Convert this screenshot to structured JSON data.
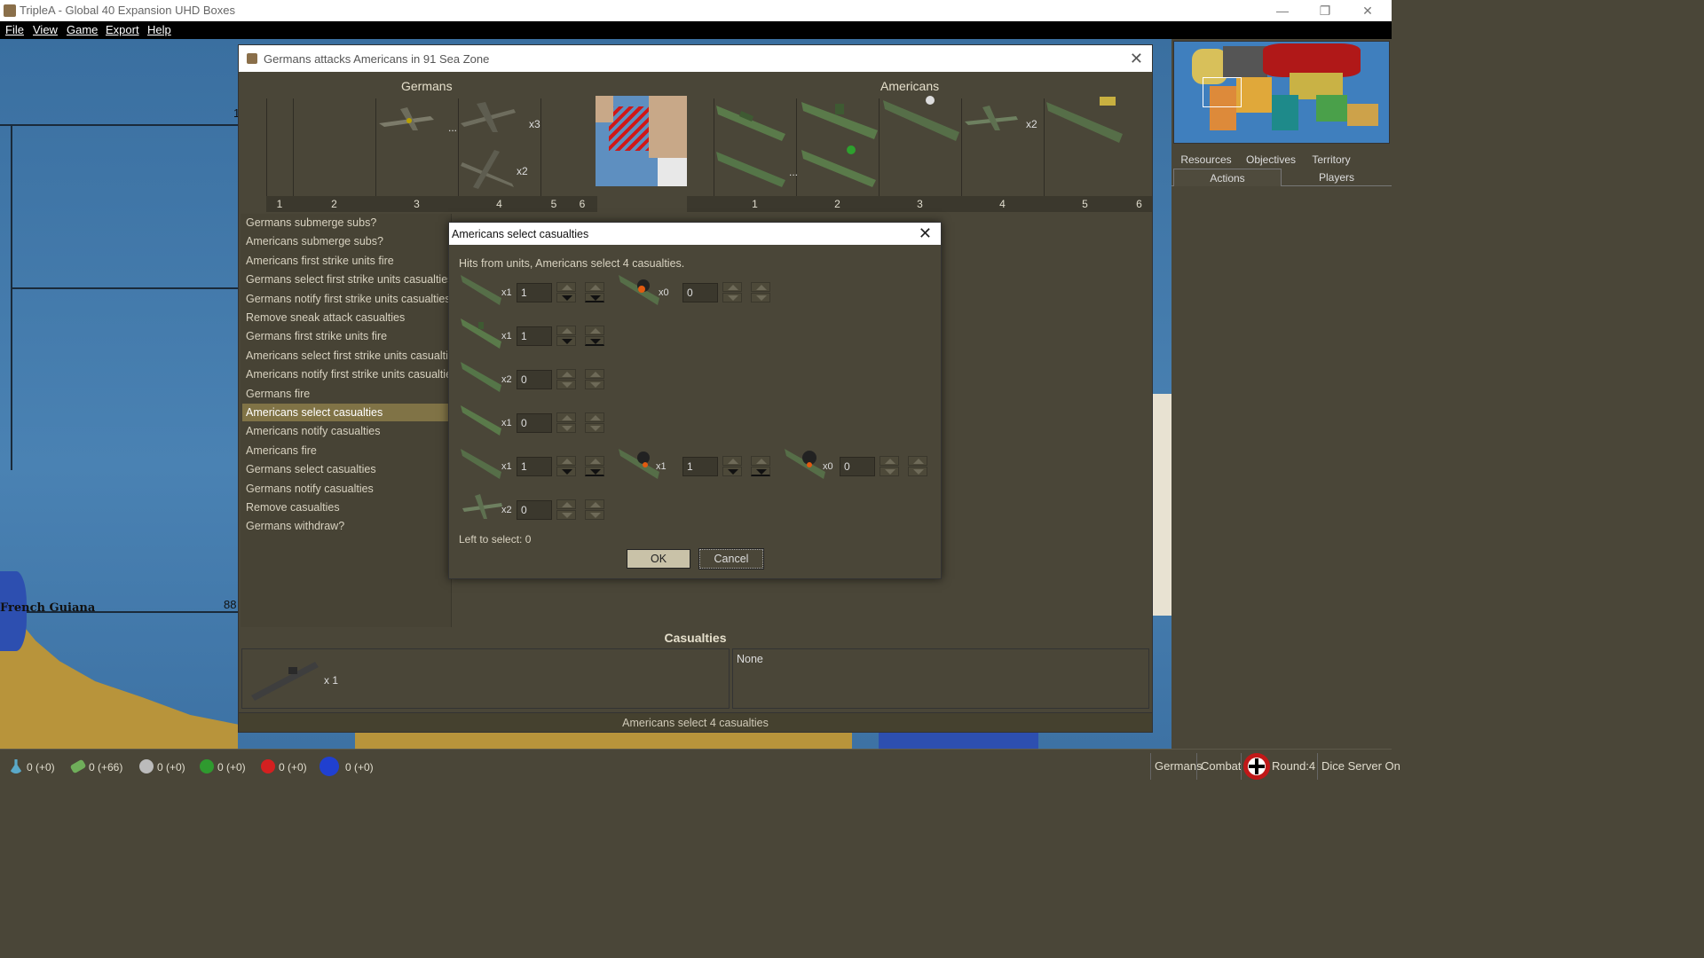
{
  "window": {
    "title": "TripleA - Global 40 Expansion UHD Boxes",
    "minimize": "—",
    "maximize": "❐",
    "close": "✕"
  },
  "menu": [
    "File",
    "View",
    "Game",
    "Export",
    "Help"
  ],
  "map": {
    "labels": {
      "french_guiana": "French Guiana",
      "zone_88": "88",
      "zone_1": "1"
    }
  },
  "right_panel": {
    "tabs_row1": [
      "Resources",
      "Objectives",
      "Territory"
    ],
    "tabs_row2": [
      "Actions",
      "Players"
    ],
    "active_tab": "Actions"
  },
  "status_bar": {
    "resources": [
      {
        "icon": "research-flask-icon",
        "value": "0 (+0)",
        "color": "#5aa9c9"
      },
      {
        "icon": "money-icon",
        "value": "0 (+66)",
        "color": "#6fae5a"
      },
      {
        "icon": "skull-icon",
        "value": "0 (+0)",
        "color": "#bbbbbb"
      },
      {
        "icon": "green-token-icon",
        "value": "0 (+0)",
        "color": "#2f9a2f"
      },
      {
        "icon": "red-token-icon",
        "value": "0 (+0)",
        "color": "#d42020"
      },
      {
        "icon": "ll-token-icon",
        "value": "0 (+0)",
        "color": "#2040d0"
      }
    ],
    "player": "Germans",
    "phase": "Combat",
    "round": "Round:4",
    "dice": "Dice Server On"
  },
  "battle": {
    "title": "Germans attacks Americans in 91 Sea Zone",
    "attacker": "Germans",
    "defender": "Americans",
    "attacker_columns": [
      "1",
      "2",
      "3",
      "4",
      "5",
      "6"
    ],
    "defender_columns": [
      "1",
      "2",
      "3",
      "4",
      "5",
      "6"
    ],
    "attacker_counts": {
      "col4_top": "x3",
      "col4_bottom": "x2"
    },
    "defender_counts": {
      "col4": "x2"
    },
    "steps": [
      "Germans submerge subs?",
      "Americans submerge subs?",
      "Americans first strike units fire",
      "Germans select first strike units casualties",
      "Germans notify first strike units casualties",
      "Remove sneak attack casualties",
      "Germans first strike units fire",
      "Americans select first strike units casualties",
      "Americans notify first strike units casualties",
      "Germans fire",
      "Americans select casualties",
      "Americans notify casualties",
      "Americans fire",
      "Germans select casualties",
      "Germans notify casualties",
      "Remove casualties",
      "Germans withdraw?"
    ],
    "selected_step": "Americans select casualties",
    "casualties_title": "Casualties",
    "casualties_left_count": "x 1",
    "casualties_right": "None",
    "status": "Americans select 4 casualties"
  },
  "dialog": {
    "title": "Americans select casualties",
    "hits_text": "Hits from units,  Americans select 4 casualties.",
    "rows": [
      {
        "mult": "x1",
        "value": "1",
        "damaged_mult": "x0",
        "damaged_value": "0"
      },
      {
        "mult": "x1",
        "value": "1"
      },
      {
        "mult": "x2",
        "value": "0"
      },
      {
        "mult": "x1",
        "value": "0"
      },
      {
        "mult": "x1",
        "value": "1",
        "damaged_mult": "x1",
        "damaged_value": "1",
        "damaged2_mult": "x0",
        "damaged2_value": "0"
      },
      {
        "mult": "x2",
        "value": "0"
      }
    ],
    "left_to_select": "Left to select: 0",
    "ok": "OK",
    "cancel": "Cancel"
  }
}
